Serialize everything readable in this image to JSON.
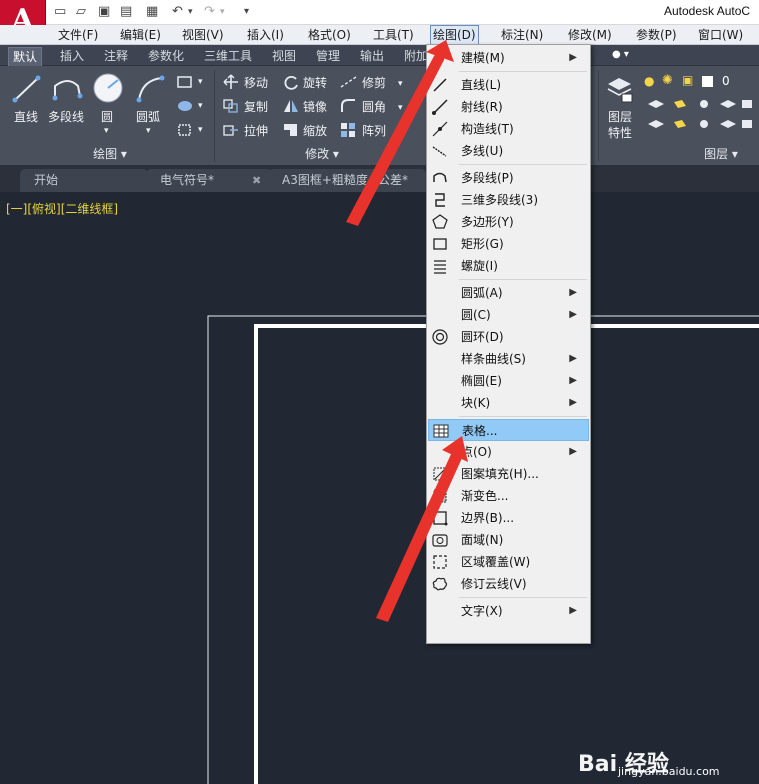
{
  "app": {
    "title": "Autodesk AutoC",
    "logo_letter": "A"
  },
  "menubar": {
    "items": [
      "文件(F)",
      "编辑(E)",
      "视图(V)",
      "插入(I)",
      "格式(O)",
      "工具(T)",
      "绘图(D)",
      "标注(N)",
      "修改(M)",
      "参数(P)",
      "窗口(W)"
    ],
    "active": "绘图(D)"
  },
  "ribbon_tabs": [
    "默认",
    "插入",
    "注释",
    "参数化",
    "三维工具",
    "视图",
    "管理",
    "输出",
    "附加"
  ],
  "ribbon": {
    "draw_panel": {
      "title": "绘图",
      "tools": [
        "直线",
        "多段线",
        "圆",
        "圆弧"
      ]
    },
    "modify_panel": {
      "title": "修改",
      "tools": [
        "移动",
        "旋转",
        "修剪",
        "复制",
        "镜像",
        "圆角",
        "拉伸",
        "缩放",
        "阵列"
      ]
    },
    "layers_panel": {
      "title": "图层",
      "layer_props": "图层\n特性",
      "layer_props_line1": "图层",
      "layer_props_line2": "特性",
      "current_layer": "0"
    }
  },
  "doc_tabs": [
    {
      "label": "开始",
      "closable": false
    },
    {
      "label": "电气符号*",
      "closable": true
    },
    {
      "label": "A3图框+粗糙度+公差*",
      "closable": true
    }
  ],
  "viewport_label": "[一][俯视][二维线框]",
  "draw_menu": {
    "items": [
      {
        "label": "建模(M)",
        "submenu": true,
        "icon": ""
      },
      {
        "sep": true
      },
      {
        "label": "直线(L)",
        "icon": "line-icon"
      },
      {
        "label": "射线(R)",
        "icon": "ray-icon"
      },
      {
        "label": "构造线(T)",
        "icon": "xline-icon"
      },
      {
        "label": "多线(U)",
        "icon": "mline-icon"
      },
      {
        "sep": true
      },
      {
        "label": "多段线(P)",
        "icon": "polyline-icon"
      },
      {
        "label": "三维多段线(3)",
        "icon": "3d-polyline-icon"
      },
      {
        "label": "多边形(Y)",
        "icon": "polygon-icon"
      },
      {
        "label": "矩形(G)",
        "icon": "rectangle-icon"
      },
      {
        "label": "螺旋(I)",
        "icon": "helix-icon"
      },
      {
        "sep": true
      },
      {
        "label": "圆弧(A)",
        "submenu": true,
        "icon": ""
      },
      {
        "label": "圆(C)",
        "submenu": true,
        "icon": ""
      },
      {
        "label": "圆环(D)",
        "icon": "donut-icon"
      },
      {
        "label": "样条曲线(S)",
        "submenu": true,
        "icon": ""
      },
      {
        "label": "椭圆(E)",
        "submenu": true,
        "icon": ""
      },
      {
        "label": "块(K)",
        "submenu": true,
        "icon": ""
      },
      {
        "sep": true
      },
      {
        "label": "表格...",
        "icon": "table-icon",
        "highlighted": true
      },
      {
        "label": "点(O)",
        "submenu": true,
        "icon": ""
      },
      {
        "label": "图案填充(H)...",
        "icon": "hatch-icon"
      },
      {
        "label": "渐变色...",
        "icon": "gradient-icon"
      },
      {
        "label": "边界(B)...",
        "icon": "boundary-icon"
      },
      {
        "label": "面域(N)",
        "icon": "region-icon"
      },
      {
        "label": "区域覆盖(W)",
        "icon": "wipeout-icon"
      },
      {
        "label": "修订云线(V)",
        "icon": "revcloud-icon"
      },
      {
        "sep": true
      },
      {
        "label": "文字(X)",
        "submenu": true,
        "icon": ""
      }
    ]
  },
  "watermark": {
    "brand": "Bai 经验",
    "url": "jingyan.baidu.com"
  },
  "colors": {
    "canvas": "#222833",
    "ribbon": "#4a505c",
    "menu_highlight": "#91c9f7",
    "annotation_arrow": "#e8322c",
    "viewport_label": "#e8d23a"
  }
}
